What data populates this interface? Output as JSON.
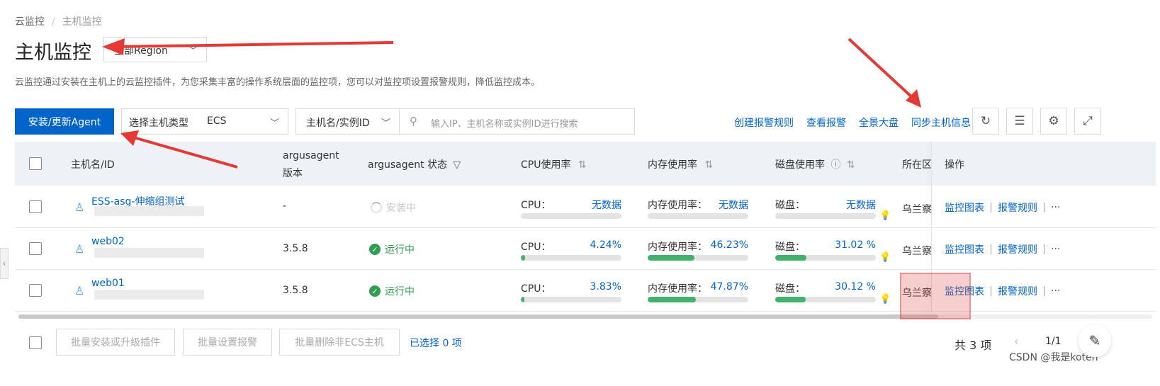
{
  "breadcrumb": [
    "云监控",
    "主机监控"
  ],
  "page": {
    "title": "主机监控",
    "region_value": "全部Region",
    "description": "云监控通过安装在主机上的云监控插件，为您采集丰富的操作系统层面的监控项，您可以对监控项设置报警规则，降低监控成本。"
  },
  "toolbar": {
    "install_button": "安装/更新Agent",
    "host_type_label": "选择主机类型",
    "host_type_value": "ECS",
    "search_field": "主机名/实例ID",
    "search_placeholder": "输入IP、主机名称或实例ID进行搜索",
    "links": [
      "创建报警规则",
      "查看报警",
      "全景大盘",
      "同步主机信息"
    ]
  },
  "table": {
    "headers": {
      "host": "主机名/ID",
      "version_line1": "argusagent",
      "version_line2": "版本",
      "status": "argusagent 状态",
      "cpu": "CPU使用率",
      "mem": "内存使用率",
      "disk": "磁盘使用率",
      "region": "所在区",
      "ops": "操作"
    },
    "rows": [
      {
        "host": "ESS-asg-伸缩组测试",
        "version": "-",
        "status": "安装中",
        "status_kind": "pending",
        "cpu_label": "CPU：",
        "cpu_value": "无数据",
        "cpu_fill": 0,
        "mem_label": "内存使用率：",
        "mem_value": "无数据",
        "mem_fill": 0,
        "disk_label": "磁盘：",
        "disk_value": "无数据",
        "disk_fill": 0,
        "region": "乌兰察",
        "op1": "监控图表",
        "op2": "报警规则",
        "more": "···"
      },
      {
        "host": "web02",
        "version": "3.5.8",
        "status": "运行中",
        "status_kind": "ok",
        "cpu_label": "CPU：",
        "cpu_value": "4.24%",
        "cpu_fill": 4.24,
        "mem_label": "内存使用率：",
        "mem_value": "46.23%",
        "mem_fill": 46.23,
        "disk_label": "磁盘：",
        "disk_value": "31.02 %",
        "disk_fill": 31.02,
        "region": "乌兰察",
        "op1": "监控图表",
        "op2": "报警规则",
        "more": "···"
      },
      {
        "host": "web01",
        "version": "3.5.8",
        "status": "运行中",
        "status_kind": "ok",
        "cpu_label": "CPU：",
        "cpu_value": "3.83%",
        "cpu_fill": 3.83,
        "mem_label": "内存使用率：",
        "mem_value": "47.87%",
        "mem_fill": 47.87,
        "disk_label": "磁盘：",
        "disk_value": "30.12 %",
        "disk_fill": 30.12,
        "region": "乌兰察",
        "op1": "监控图表",
        "op2": "报警规则",
        "more": "···"
      }
    ]
  },
  "footer": {
    "batch_install": "批量安装或升级插件",
    "batch_alarm": "批量设置报警",
    "batch_delete": "批量删除非ECS主机",
    "selected": "已选择 0 项",
    "total": "共 3 项",
    "page": "1/1"
  },
  "watermark": "CSDN @我是koten",
  "colors": {
    "primary": "#0064c8",
    "success": "#2e9e4f",
    "bar_fill": "#40b26b",
    "annotation_arrow": "#e53935"
  }
}
